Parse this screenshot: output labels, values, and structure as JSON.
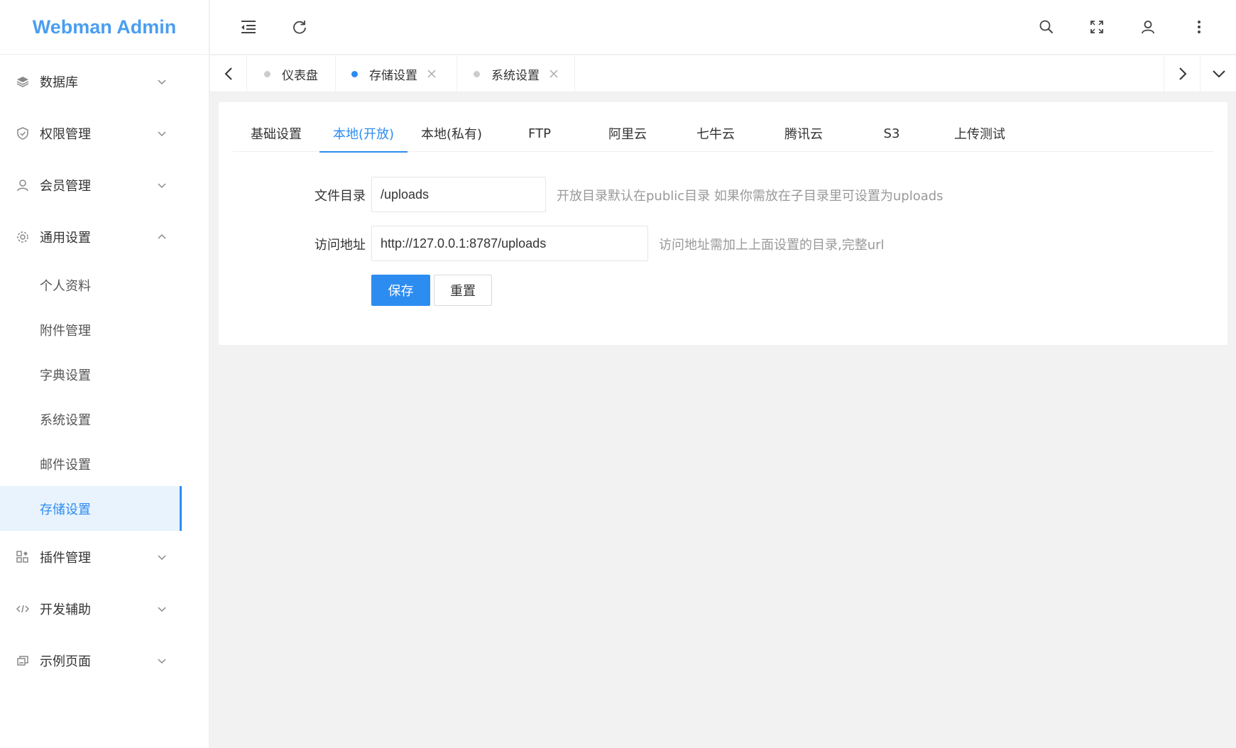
{
  "app": {
    "title": "Webman Admin"
  },
  "sidebar": {
    "items": [
      {
        "label": "数据库",
        "icon": "layers-icon"
      },
      {
        "label": "权限管理",
        "icon": "shield-icon"
      },
      {
        "label": "会员管理",
        "icon": "user-icon"
      },
      {
        "label": "通用设置",
        "icon": "gear-icon",
        "expanded": true,
        "children": [
          "个人资料",
          "附件管理",
          "字典设置",
          "系统设置",
          "邮件设置",
          "存储设置"
        ],
        "active_child": "存储设置"
      },
      {
        "label": "插件管理",
        "icon": "apps-icon"
      },
      {
        "label": "开发辅助",
        "icon": "code-icon"
      },
      {
        "label": "示例页面",
        "icon": "template-icon"
      }
    ]
  },
  "tabs": [
    {
      "label": "仪表盘",
      "closable": false,
      "active": false
    },
    {
      "label": "存储设置",
      "closable": true,
      "active": true
    },
    {
      "label": "系统设置",
      "closable": true,
      "active": false
    }
  ],
  "content_tabs": [
    "基础设置",
    "本地(开放)",
    "本地(私有)",
    "FTP",
    "阿里云",
    "七牛云",
    "腾讯云",
    "S3",
    "上传测试"
  ],
  "content_active_tab": "本地(开放)",
  "form": {
    "dir_label": "文件目录",
    "dir_value": "/uploads",
    "dir_hint": "开放目录默认在public目录 如果你需放在子目录里可设置为uploads",
    "url_label": "访问地址",
    "url_value": "http://127.0.0.1:8787/uploads",
    "url_hint": "访问地址需加上上面设置的目录,完整url",
    "save_label": "保存",
    "reset_label": "重置"
  },
  "colors": {
    "accent": "#2d8cf0",
    "logo": "#4a9ef0",
    "active_bg": "#e8f3fe"
  }
}
